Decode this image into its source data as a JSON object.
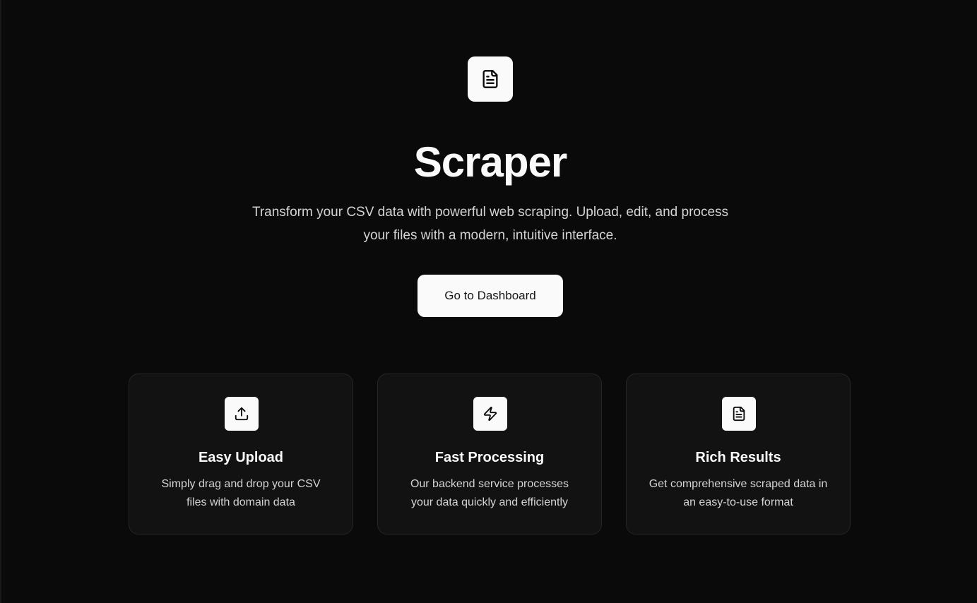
{
  "hero": {
    "logo_icon": "file-text-icon",
    "title": "Scraper",
    "subtitle": "Transform your CSV data with powerful web scraping. Upload, edit, and process your files with a modern, intuitive interface.",
    "cta_label": "Go to Dashboard"
  },
  "features": [
    {
      "icon": "upload-icon",
      "title": "Easy Upload",
      "description": "Simply drag and drop your CSV files with domain data"
    },
    {
      "icon": "zap-icon",
      "title": "Fast Processing",
      "description": "Our backend service processes your data quickly and efficiently"
    },
    {
      "icon": "file-text-icon",
      "title": "Rich Results",
      "description": "Get comprehensive scraped data in an easy-to-use format"
    }
  ],
  "colors": {
    "background": "#0a0a0a",
    "card_background": "#121212",
    "card_border": "#262626",
    "foreground": "#fafafa",
    "muted_text": "#d4d4d4"
  }
}
